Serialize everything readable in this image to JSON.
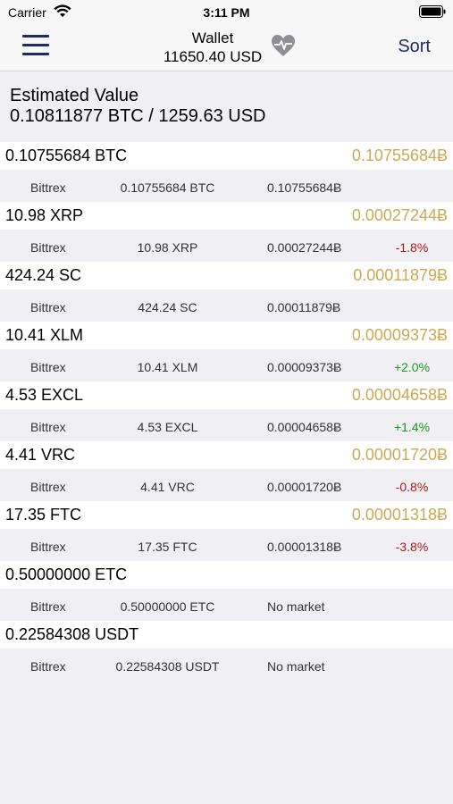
{
  "status": {
    "carrier": "Carrier",
    "time": "3:11 PM"
  },
  "nav": {
    "title": "Wallet",
    "subtitle": "11650.40 USD",
    "sort_label": "Sort"
  },
  "estimate": {
    "label": "Estimated Value",
    "value": "0.10811877 BTC / 1259.63 USD"
  },
  "coins": [
    {
      "amount": "0.10755684 BTC",
      "btc": "0.10755684Ƀ",
      "exchange": "Bittrex",
      "qty": "0.10755684 BTC",
      "price": "0.10755684Ƀ",
      "change": ""
    },
    {
      "amount": "10.98 XRP",
      "btc": "0.00027244Ƀ",
      "exchange": "Bittrex",
      "qty": "10.98 XRP",
      "price": "0.00027244Ƀ",
      "change": "-1.8%"
    },
    {
      "amount": "424.24 SC",
      "btc": "0.00011879Ƀ",
      "exchange": "Bittrex",
      "qty": "424.24 SC",
      "price": "0.00011879Ƀ",
      "change": ""
    },
    {
      "amount": "10.41 XLM",
      "btc": "0.00009373Ƀ",
      "exchange": "Bittrex",
      "qty": "10.41 XLM",
      "price": "0.00009373Ƀ",
      "change": "+2.0%"
    },
    {
      "amount": "4.53 EXCL",
      "btc": "0.00004658Ƀ",
      "exchange": "Bittrex",
      "qty": "4.53 EXCL",
      "price": "0.00004658Ƀ",
      "change": "+1.4%"
    },
    {
      "amount": "4.41 VRC",
      "btc": "0.00001720Ƀ",
      "exchange": "Bittrex",
      "qty": "4.41 VRC",
      "price": "0.00001720Ƀ",
      "change": "-0.8%"
    },
    {
      "amount": "17.35 FTC",
      "btc": "0.00001318Ƀ",
      "exchange": "Bittrex",
      "qty": "17.35 FTC",
      "price": "0.00001318Ƀ",
      "change": "-3.8%"
    },
    {
      "amount": "0.50000000 ETC",
      "btc": "",
      "exchange": "Bittrex",
      "qty": "0.50000000 ETC",
      "price": "No market",
      "change": ""
    },
    {
      "amount": "0.22584308 USDT",
      "btc": "",
      "exchange": "Bittrex",
      "qty": "0.22584308 USDT",
      "price": "No market",
      "change": ""
    }
  ],
  "colors": {
    "accent": "#1f2a6b",
    "btc_gold": "#c9a953",
    "negative": "#b01818",
    "positive": "#1f9a1f"
  }
}
